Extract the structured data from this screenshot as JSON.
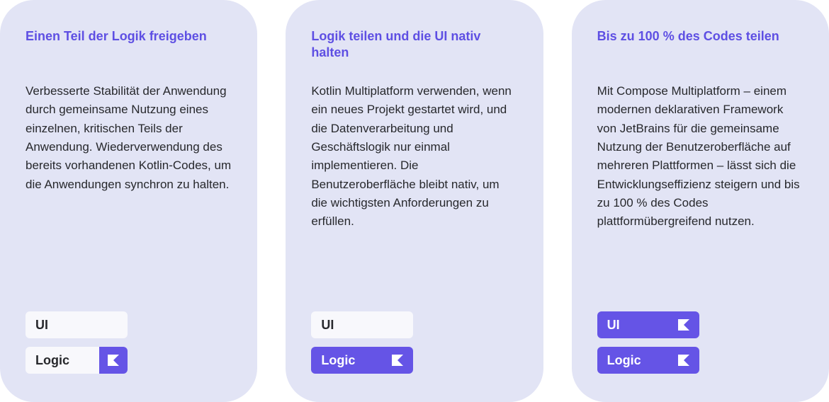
{
  "cards": [
    {
      "title": "Einen Teil der Logik freigeben",
      "description": "Verbesserte Stabilität der Anwendung durch gemeinsame Nutzung eines einzelnen, kritischen Teils der Anwendung. Wiederverwendung des bereits vorhandenen Kotlin-Codes, um die Anwendungen synchron zu halten.",
      "pills": [
        {
          "label": "UI",
          "style": "light",
          "icon": false
        },
        {
          "label": "Logic",
          "style": "split",
          "icon": true
        }
      ]
    },
    {
      "title": "Logik teilen und die UI nativ halten",
      "description": "Kotlin Multiplatform verwenden, wenn ein neues Projekt gestartet wird, und die Datenverarbeitung und Geschäftslogik nur einmal implementieren. Die Benutzeroberfläche bleibt nativ, um die wichtigsten Anforderungen zu erfüllen.",
      "pills": [
        {
          "label": "UI",
          "style": "light",
          "icon": false
        },
        {
          "label": "Logic",
          "style": "purple",
          "icon": true
        }
      ]
    },
    {
      "title": "Bis zu 100 % des Codes teilen",
      "description": "Mit Compose Multiplatform – einem modernen deklarativen Framework von JetBrains für die gemeinsame Nutzung der Benutzeroberfläche auf mehreren Plattformen – lässt sich die Entwicklungseffizienz steigern und bis zu 100 % des Codes plattformübergreifend nutzen.",
      "pills": [
        {
          "label": "UI",
          "style": "purple",
          "icon": true
        },
        {
          "label": "Logic",
          "style": "purple",
          "icon": true
        }
      ]
    }
  ]
}
